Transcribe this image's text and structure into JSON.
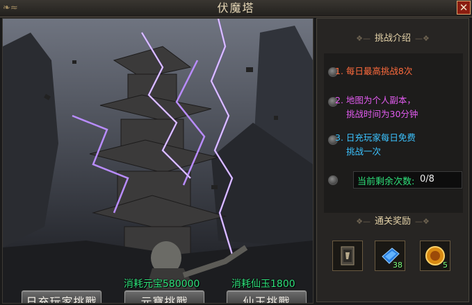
{
  "window": {
    "title": "伏魔塔",
    "close_label": "✕"
  },
  "scene": {
    "cost_yuanbao": "消耗元宝580000",
    "cost_xianyu": "消耗仙玉1800",
    "buttons": {
      "recharge": "日充玩家挑戰",
      "yuanbao": "元寶挑戰",
      "xianyu": "仙玉挑戰"
    }
  },
  "panel": {
    "intro_title": "挑战介绍",
    "rules": [
      {
        "line1": "1. 每日最高挑战8次",
        "line2": ""
      },
      {
        "line1": "2. 地图为个人副本，",
        "line2": "挑战时间为30分钟"
      },
      {
        "line1": "3. 日充玩家每日免费",
        "line2": "挑战一次"
      }
    ],
    "remaining_label": "当前剩余次数:",
    "remaining_value": "0/8",
    "reward_title": "通关奖励",
    "rewards": [
      {
        "icon": "scroll-item-icon",
        "count": ""
      },
      {
        "icon": "blue-gem-icon",
        "count": "38"
      },
      {
        "icon": "gold-medal-icon",
        "count": "5"
      }
    ]
  },
  "colors": {
    "accent_green": "#2ee07a",
    "rule1": "#ff6b3d",
    "rule2": "#e25bf0",
    "rule3": "#3cc3ff"
  }
}
